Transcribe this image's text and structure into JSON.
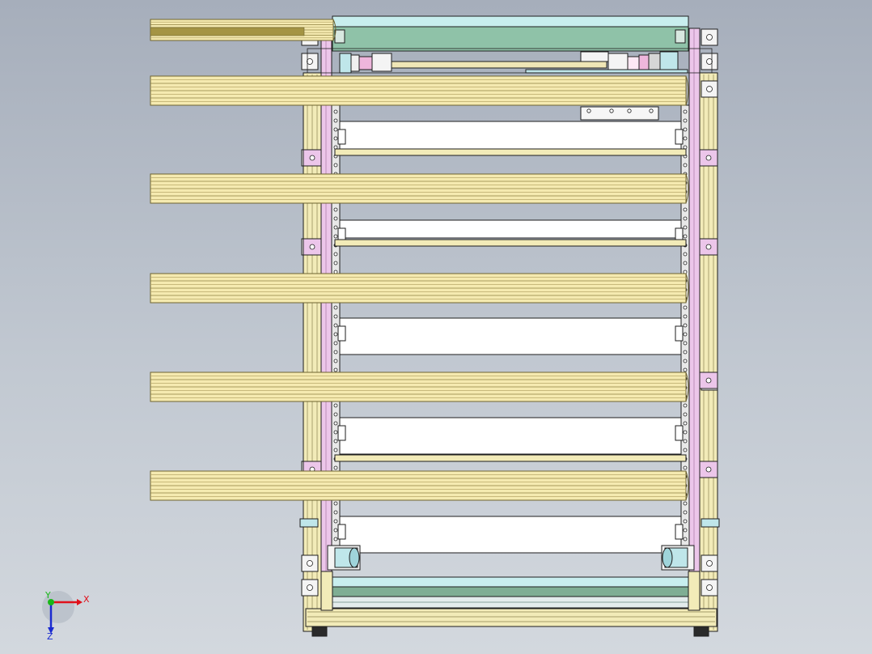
{
  "axis_triad": {
    "x_label": "X",
    "y_label": "Y",
    "z_label": "Z",
    "x_color": "#e0101a",
    "y_color": "#18b818",
    "z_color": "#1a2ad0"
  },
  "colors": {
    "background_top": "#a6aebb",
    "background_bottom": "#d3d8de",
    "rod_fill": "#f5eab0",
    "rod_line": "#6e6430",
    "frame_fill": "#f2ebb8",
    "pink_plate": "#ecc6ea",
    "slot_fill": "#ffffff",
    "top_green_panel": "#8fc2a8",
    "top_cyan_panel": "#c8eeee",
    "bottom_green_bar": "#7fae94",
    "coupling_cyan": "#bfe6ea",
    "coupling_pink": "#eeb6dc",
    "outline": "#1e1e1e",
    "foot": "#2a2a2a"
  },
  "model": {
    "rod_count": 6,
    "tray_count": 5
  }
}
